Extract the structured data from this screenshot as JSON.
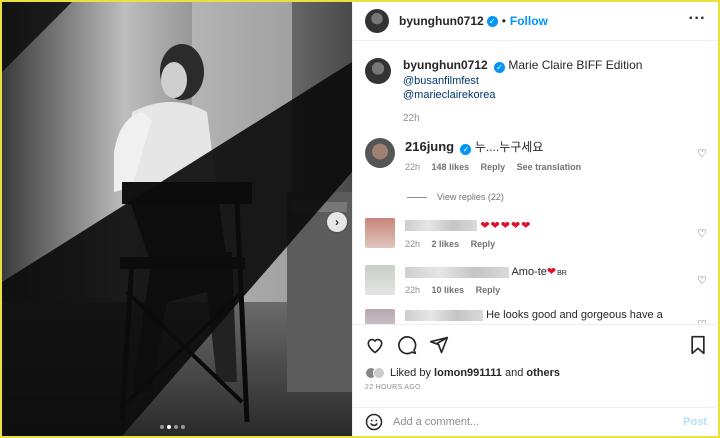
{
  "header": {
    "username": "byunghun0712",
    "separator": "•",
    "follow_label": "Follow",
    "more_icon": "more-horizontal-icon"
  },
  "caption": {
    "username": "byunghun0712",
    "text": "Marie Claire BIFF Edition",
    "mentions": [
      "@busanfilmfest",
      "@marieclairekorea"
    ],
    "time": "22h"
  },
  "comments": [
    {
      "username": "216jung",
      "text": "누....누구세요",
      "time": "22h",
      "likes": "148 likes",
      "reply_label": "Reply",
      "translation_label": "See translation",
      "view_replies": "View replies (22)"
    },
    {
      "username": "",
      "text": "❤❤❤❤❤",
      "time": "22h",
      "likes": "2 likes",
      "reply_label": "Reply"
    },
    {
      "username": "",
      "text": "Amo-te",
      "flag": "BR",
      "time": "22h",
      "likes": "10 likes",
      "reply_label": "Reply"
    },
    {
      "username": "",
      "text": "He looks good and gorgeous have a"
    }
  ],
  "actions": {
    "liked_by_prefix": "Liked by",
    "liked_by_user": "lomon991111",
    "liked_by_and": "and",
    "liked_by_others": "others",
    "time_ago": "22 HOURS AGO"
  },
  "add_comment": {
    "placeholder": "Add a comment...",
    "post_label": "Post"
  },
  "colors": {
    "accent": "#0095f6",
    "heart": "#e0102f",
    "muted": "#8e8e8e",
    "frame": "#e8e23a"
  }
}
